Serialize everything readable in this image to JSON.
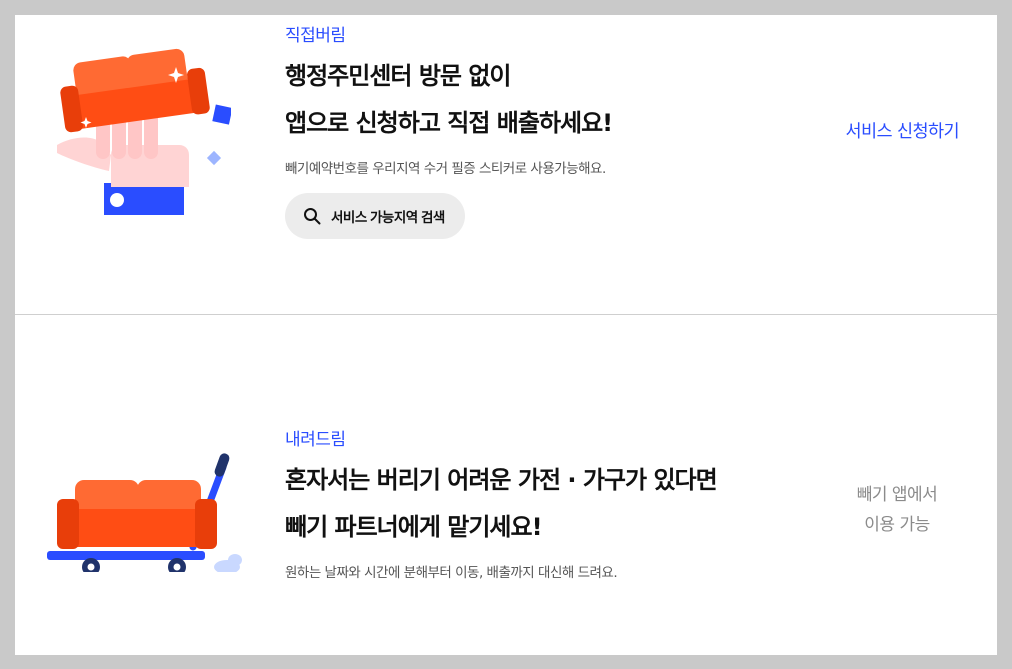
{
  "services": {
    "direct": {
      "tag": "직접버림",
      "title_line1": "행정주민센터 방문 없이",
      "title_line2": "앱으로 신청하고 직접 배출하세요!",
      "description": "빼기예약번호를 우리지역 수거 필증 스티커로 사용가능해요.",
      "search_button_label": "서비스 가능지역 검색",
      "search_icon": "search-icon",
      "apply_link_label": "서비스 신청하기"
    },
    "pickup": {
      "tag": "내려드림",
      "title_line1": "혼자서는 버리기 어려운 가전 · 가구가 있다면",
      "title_line2": "빼기 파트너에게 맡기세요!",
      "description": "원하는 날짜와 시간에 분해부터 이동, 배출까지 대신해 드려요.",
      "note_line1": "빼기 앱에서",
      "note_line2": "이용 가능"
    }
  },
  "colors": {
    "accent": "#2a4dff",
    "sofa": "#ff5a1f",
    "page_background": "#c9c9c9",
    "button_background": "#ececec"
  }
}
